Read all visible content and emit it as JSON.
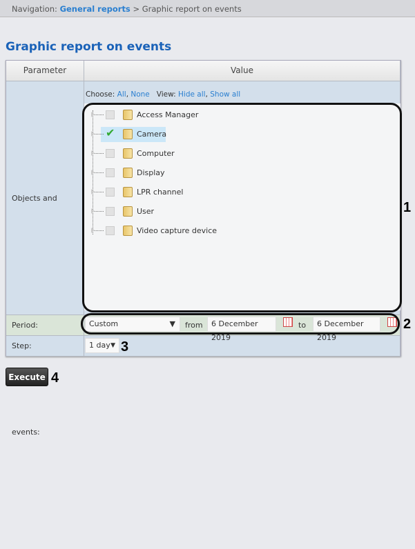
{
  "nav": {
    "prefix": "Navigation:",
    "link": "General reports",
    "sep": ">",
    "current": "Graphic report on events"
  },
  "title": "Graphic report on events",
  "table": {
    "col_param": "Parameter",
    "col_value": "Value"
  },
  "objects": {
    "label": "Objects and events:",
    "choose": "Choose:",
    "all": "All",
    "none": "None",
    "view": "View:",
    "hide_all": "Hide all",
    "show_all": "Show all",
    "items": [
      {
        "label": "Access Manager",
        "checked": false
      },
      {
        "label": "Camera",
        "checked": true
      },
      {
        "label": "Computer",
        "checked": false
      },
      {
        "label": "Display",
        "checked": false
      },
      {
        "label": "LPR channel",
        "checked": false
      },
      {
        "label": "User",
        "checked": false
      },
      {
        "label": "Video capture device",
        "checked": false
      }
    ]
  },
  "period": {
    "label": "Period:",
    "value": "Custom",
    "from_label": "from",
    "from": "6 December 2019",
    "to_label": "to",
    "to": "6 December 2019"
  },
  "step": {
    "label": "Step:",
    "value": "1 day"
  },
  "execute": "Execute",
  "callouts": [
    "1",
    "2",
    "3",
    "4"
  ]
}
